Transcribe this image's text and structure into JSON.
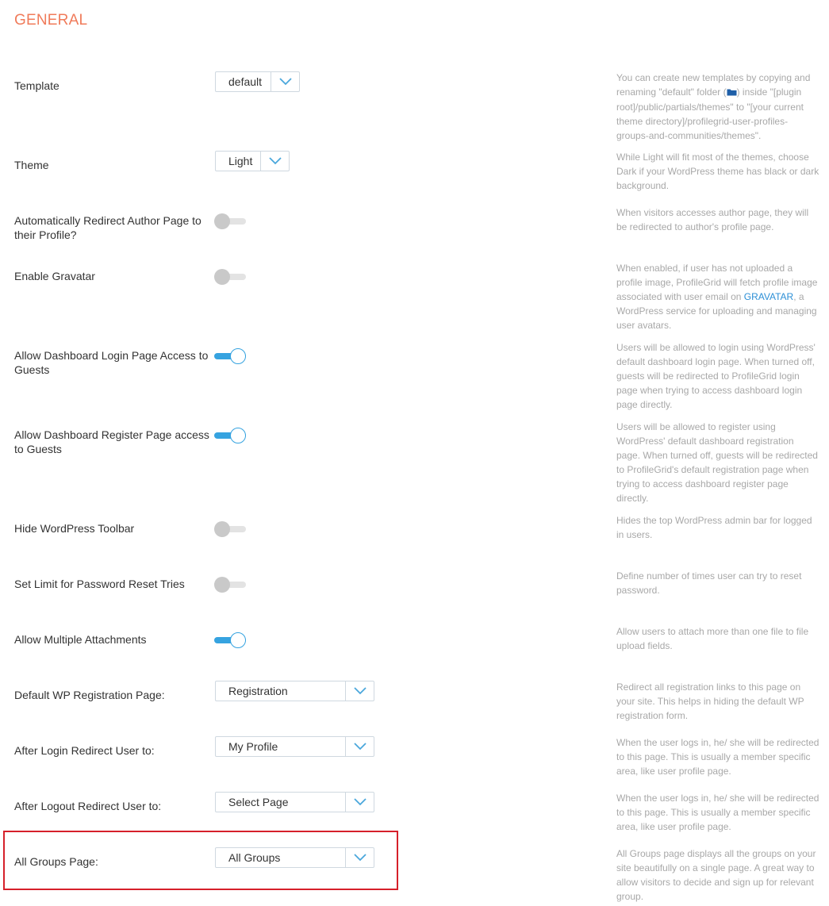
{
  "section": {
    "title": "GENERAL"
  },
  "template": {
    "label": "Template",
    "value": "default",
    "desc_part1": "You can create new templates by copying and renaming \"default\" folder (",
    "desc_icon": "folder-icon",
    "desc_part2": ") inside \"[plugin root]/public/partials/themes\" to \"[your current theme directory]/profilegrid-user-profiles-groups-and-communities/themes\"."
  },
  "theme": {
    "label": "Theme",
    "value": "Light",
    "desc": "While Light will fit most of the themes, choose Dark if your WordPress theme has black or dark background."
  },
  "redirect_author": {
    "label": "Automatically Redirect Author Page to their Profile?",
    "enabled": false,
    "desc": "When visitors accesses author page, they will be redirected to author's profile page."
  },
  "gravatar": {
    "label": "Enable Gravatar",
    "enabled": false,
    "desc_part1": "When enabled, if user has not uploaded a profile image, ProfileGrid will fetch profile image associated with user email on ",
    "desc_link": "GRAVATAR",
    "desc_part2": ", a WordPress service for uploading and managing user avatars."
  },
  "dashboard_login": {
    "label": "Allow Dashboard Login Page Access to Guests",
    "enabled": true,
    "desc": "Users will be allowed to login using WordPress' default dashboard login page. When turned off, guests will be redirected to ProfileGrid login page when trying to access dashboard login page directly."
  },
  "dashboard_register": {
    "label": "Allow Dashboard Register Page access to Guests",
    "enabled": true,
    "desc": "Users will be allowed to register using WordPress' default dashboard registration page. When turned off, guests will be redirected to ProfileGrid's default registration page when trying to access dashboard register page directly."
  },
  "hide_toolbar": {
    "label": "Hide WordPress Toolbar",
    "enabled": false,
    "desc": "Hides the top WordPress admin bar for logged in users."
  },
  "password_reset": {
    "label": "Set Limit for Password Reset Tries",
    "enabled": false,
    "desc": "Define number of times user can try to reset password."
  },
  "multiple_attachments": {
    "label": "Allow Multiple Attachments",
    "enabled": true,
    "desc": "Allow users to attach more than one file to file upload fields."
  },
  "wp_registration": {
    "label": "Default WP Registration Page:",
    "value": "Registration",
    "desc": "Redirect all registration links to this page on your site. This helps in hiding the default WP registration form."
  },
  "login_redirect": {
    "label": "After Login Redirect User to:",
    "value": "My Profile",
    "desc": "When the user logs in, he/ she will be redirected to this page. This is usually a member specific area, like user profile page."
  },
  "logout_redirect": {
    "label": "After Logout Redirect User to:",
    "value": "Select Page",
    "desc": "When the user logs in, he/ she will be redirected to this page. This is usually a member specific area, like user profile page."
  },
  "all_groups": {
    "label": "All Groups Page:",
    "value": "All Groups",
    "desc": "All Groups page displays all the groups on your site beautifully on a single page. A great way to allow visitors to decide and sign up for relevant group."
  },
  "colors": {
    "accent_title": "#f07b5a",
    "toggle_on": "#36a3e0",
    "highlight_border": "#d6202a",
    "link": "#2c8fd6"
  }
}
